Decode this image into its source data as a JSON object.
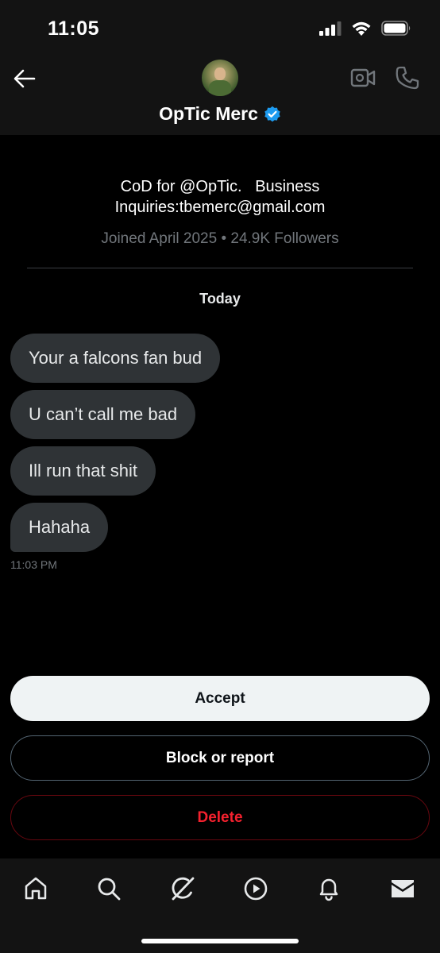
{
  "status_bar": {
    "time": "11:05"
  },
  "header": {
    "name": "OpTic Merc",
    "verified": true,
    "accent_color": "#1d9bf0"
  },
  "profile": {
    "bio_line1": "CoD for @OpTic.   Business",
    "bio_line2": "Inquiries:tbemerc@gmail.com",
    "meta": "Joined April 2025 • 24.9K Followers"
  },
  "conversation": {
    "date_label": "Today",
    "messages": [
      {
        "text": "Your a falcons fan bud"
      },
      {
        "text": "U can’t call me bad"
      },
      {
        "text": "Ill run that shit"
      },
      {
        "text": "Hahaha"
      }
    ],
    "last_time": "11:03 PM"
  },
  "actions": {
    "accept": "Accept",
    "block_report": "Block or report",
    "delete": "Delete",
    "delete_color": "#f4212e"
  },
  "nav": {
    "items": [
      "home-icon",
      "search-icon",
      "grok-icon",
      "video-play-icon",
      "notifications-icon",
      "messages-icon"
    ],
    "active": "messages-icon"
  }
}
